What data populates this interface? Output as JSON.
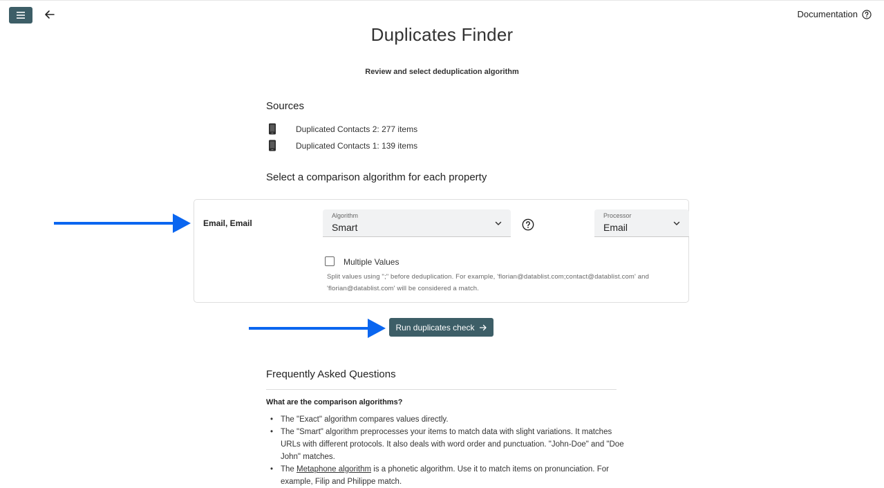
{
  "header": {
    "menu_icon": "hamburger-menu-icon",
    "back_icon": "arrow-left-icon",
    "documentation_label": "Documentation",
    "documentation_icon": "question-circle-icon"
  },
  "page": {
    "title": "Duplicates Finder",
    "subtitle": "Review and select deduplication algorithm"
  },
  "sources": {
    "heading": "Sources",
    "items": [
      {
        "icon": "phone-icon",
        "label": "Duplicated Contacts 2: 277 items"
      },
      {
        "icon": "phone-icon",
        "label": "Duplicated Contacts 1: 139 items"
      }
    ]
  },
  "comparison": {
    "heading": "Select a comparison algorithm for each property",
    "property_label": "Email, Email",
    "algorithm_caption": "Algorithm",
    "algorithm_value": "Smart",
    "processor_caption": "Processor",
    "processor_value": "Email",
    "multiple_values_label": "Multiple Values",
    "multiple_values_checked": false,
    "multiple_values_help": "Split values using \";\" before deduplication. For example, 'florian@datablist.com;contact@datablist.com' and 'florian@datablist.com' will be considered a match."
  },
  "actions": {
    "run_label": "Run duplicates check"
  },
  "annotation_color": "#0a66f0",
  "brand_color": "#3d5e67",
  "faq": {
    "heading": "Frequently Asked Questions",
    "question": "What are the comparison algorithms?",
    "items": [
      {
        "text": "The \"Exact\" algorithm compares values directly."
      },
      {
        "text": "The \"Smart\" algorithm preprocesses your items to match data with slight variations. It matches URLs with different protocols. It also deals with word order and punctuation. \"John-Doe\" and \"Doe John\" matches."
      },
      {
        "prefix": "The ",
        "link": "Metaphone algorithm",
        "text": " is a phonetic algorithm. Use it to match items on pronunciation. For example, Filip and Philippe match."
      }
    ]
  }
}
